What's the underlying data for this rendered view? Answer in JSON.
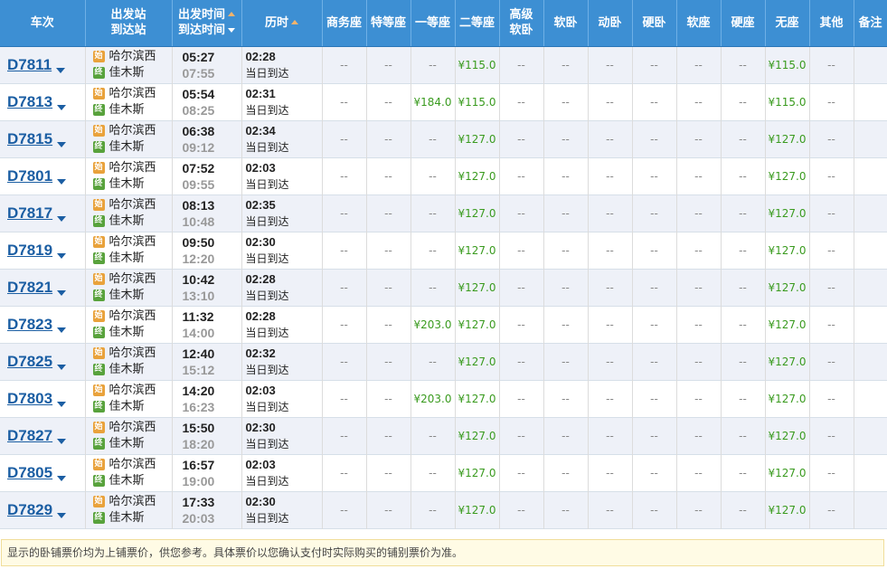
{
  "header": {
    "train_no": "车次",
    "from_station": "出发站",
    "to_station": "到达站",
    "depart_time": "出发时间",
    "arrive_time": "到达时间",
    "duration": "历时",
    "seats": [
      "商务座",
      "特等座",
      "一等座",
      "二等座",
      "高级软卧",
      "软卧",
      "动卧",
      "硬卧",
      "软座",
      "硬座",
      "无座",
      "其他",
      "备注"
    ]
  },
  "badges": {
    "start": "始",
    "end": "终"
  },
  "trains": [
    {
      "no": "D7811",
      "from": "哈尔滨西",
      "to": "佳木斯",
      "dep": "05:27",
      "arr": "07:55",
      "dur": "02:28",
      "arrive_note": "当日到达",
      "seats": [
        "--",
        "--",
        "--",
        "¥115.0",
        "--",
        "--",
        "--",
        "--",
        "--",
        "--",
        "¥115.0",
        "--",
        ""
      ]
    },
    {
      "no": "D7813",
      "from": "哈尔滨西",
      "to": "佳木斯",
      "dep": "05:54",
      "arr": "08:25",
      "dur": "02:31",
      "arrive_note": "当日到达",
      "seats": [
        "--",
        "--",
        "¥184.0",
        "¥115.0",
        "--",
        "--",
        "--",
        "--",
        "--",
        "--",
        "¥115.0",
        "--",
        ""
      ]
    },
    {
      "no": "D7815",
      "from": "哈尔滨西",
      "to": "佳木斯",
      "dep": "06:38",
      "arr": "09:12",
      "dur": "02:34",
      "arrive_note": "当日到达",
      "seats": [
        "--",
        "--",
        "--",
        "¥127.0",
        "--",
        "--",
        "--",
        "--",
        "--",
        "--",
        "¥127.0",
        "--",
        ""
      ]
    },
    {
      "no": "D7801",
      "from": "哈尔滨西",
      "to": "佳木斯",
      "dep": "07:52",
      "arr": "09:55",
      "dur": "02:03",
      "arrive_note": "当日到达",
      "seats": [
        "--",
        "--",
        "--",
        "¥127.0",
        "--",
        "--",
        "--",
        "--",
        "--",
        "--",
        "¥127.0",
        "--",
        ""
      ]
    },
    {
      "no": "D7817",
      "from": "哈尔滨西",
      "to": "佳木斯",
      "dep": "08:13",
      "arr": "10:48",
      "dur": "02:35",
      "arrive_note": "当日到达",
      "seats": [
        "--",
        "--",
        "--",
        "¥127.0",
        "--",
        "--",
        "--",
        "--",
        "--",
        "--",
        "¥127.0",
        "--",
        ""
      ]
    },
    {
      "no": "D7819",
      "from": "哈尔滨西",
      "to": "佳木斯",
      "dep": "09:50",
      "arr": "12:20",
      "dur": "02:30",
      "arrive_note": "当日到达",
      "seats": [
        "--",
        "--",
        "--",
        "¥127.0",
        "--",
        "--",
        "--",
        "--",
        "--",
        "--",
        "¥127.0",
        "--",
        ""
      ]
    },
    {
      "no": "D7821",
      "from": "哈尔滨西",
      "to": "佳木斯",
      "dep": "10:42",
      "arr": "13:10",
      "dur": "02:28",
      "arrive_note": "当日到达",
      "seats": [
        "--",
        "--",
        "--",
        "¥127.0",
        "--",
        "--",
        "--",
        "--",
        "--",
        "--",
        "¥127.0",
        "--",
        ""
      ]
    },
    {
      "no": "D7823",
      "from": "哈尔滨西",
      "to": "佳木斯",
      "dep": "11:32",
      "arr": "14:00",
      "dur": "02:28",
      "arrive_note": "当日到达",
      "seats": [
        "--",
        "--",
        "¥203.0",
        "¥127.0",
        "--",
        "--",
        "--",
        "--",
        "--",
        "--",
        "¥127.0",
        "--",
        ""
      ]
    },
    {
      "no": "D7825",
      "from": "哈尔滨西",
      "to": "佳木斯",
      "dep": "12:40",
      "arr": "15:12",
      "dur": "02:32",
      "arrive_note": "当日到达",
      "seats": [
        "--",
        "--",
        "--",
        "¥127.0",
        "--",
        "--",
        "--",
        "--",
        "--",
        "--",
        "¥127.0",
        "--",
        ""
      ]
    },
    {
      "no": "D7803",
      "from": "哈尔滨西",
      "to": "佳木斯",
      "dep": "14:20",
      "arr": "16:23",
      "dur": "02:03",
      "arrive_note": "当日到达",
      "seats": [
        "--",
        "--",
        "¥203.0",
        "¥127.0",
        "--",
        "--",
        "--",
        "--",
        "--",
        "--",
        "¥127.0",
        "--",
        ""
      ]
    },
    {
      "no": "D7827",
      "from": "哈尔滨西",
      "to": "佳木斯",
      "dep": "15:50",
      "arr": "18:20",
      "dur": "02:30",
      "arrive_note": "当日到达",
      "seats": [
        "--",
        "--",
        "--",
        "¥127.0",
        "--",
        "--",
        "--",
        "--",
        "--",
        "--",
        "¥127.0",
        "--",
        ""
      ]
    },
    {
      "no": "D7805",
      "from": "哈尔滨西",
      "to": "佳木斯",
      "dep": "16:57",
      "arr": "19:00",
      "dur": "02:03",
      "arrive_note": "当日到达",
      "seats": [
        "--",
        "--",
        "--",
        "¥127.0",
        "--",
        "--",
        "--",
        "--",
        "--",
        "--",
        "¥127.0",
        "--",
        ""
      ]
    },
    {
      "no": "D7829",
      "from": "哈尔滨西",
      "to": "佳木斯",
      "dep": "17:33",
      "arr": "20:03",
      "dur": "02:30",
      "arrive_note": "当日到达",
      "seats": [
        "--",
        "--",
        "--",
        "¥127.0",
        "--",
        "--",
        "--",
        "--",
        "--",
        "--",
        "¥127.0",
        "--",
        ""
      ]
    }
  ],
  "notice": "显示的卧铺票价均为上铺票价，供您参考。具体票价以您确认支付时实际购买的铺别票价为准。",
  "colors": {
    "header_bg": "#3d8fd3",
    "price": "#3a9b1f",
    "train_link": "#1b5ea3",
    "row_alt": "#eef1f8"
  }
}
